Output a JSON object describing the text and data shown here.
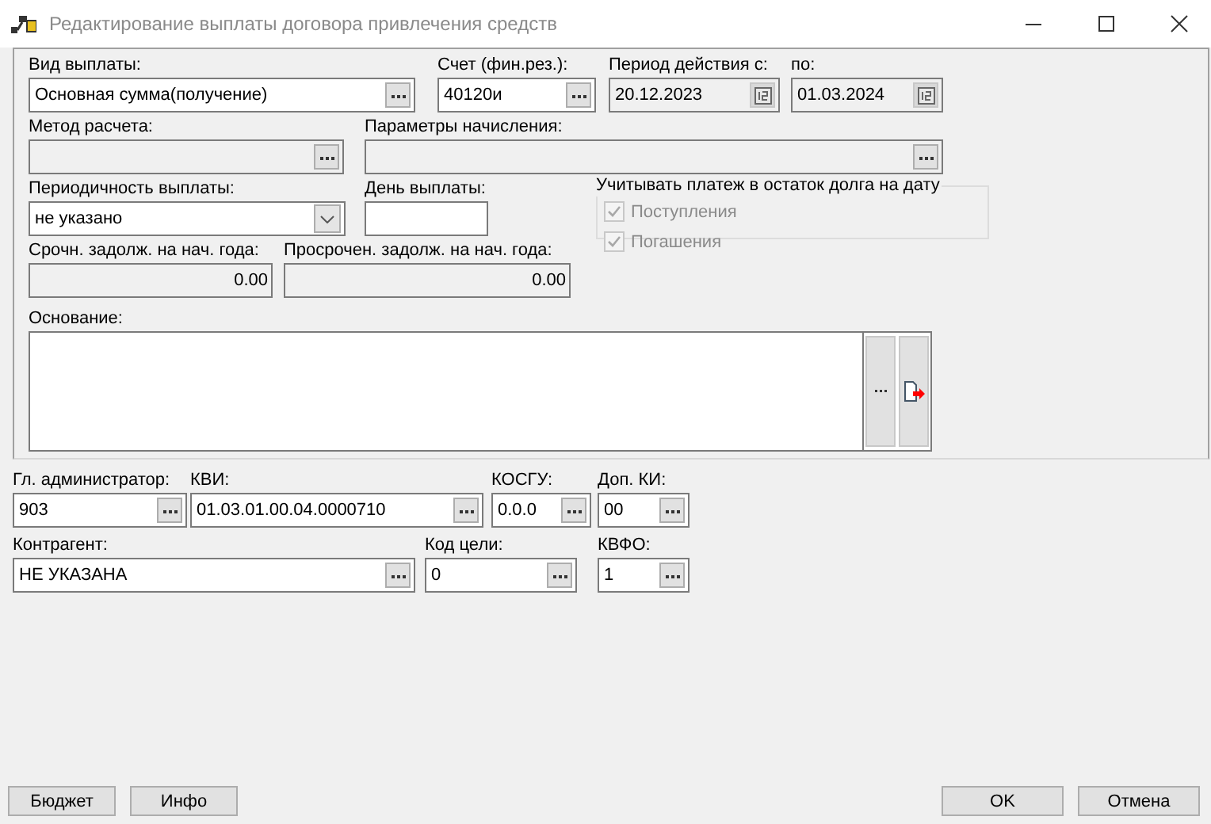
{
  "window": {
    "title": "Редактирование выплаты договора привлечения средств"
  },
  "top_rows": [
    [
      {
        "label": "Вид выплаты:",
        "value": "Основная сумма(получение)",
        "kind": "lookup",
        "disabled": false
      },
      {
        "label": "Счет (фин.рез.):",
        "value": "40120и",
        "kind": "lookup",
        "disabled": false
      },
      {
        "label": "Период действия с:",
        "value": "20.12.2023",
        "kind": "date",
        "disabled": true
      },
      {
        "label": "по:",
        "value": "01.03.2024",
        "kind": "date",
        "disabled": true
      }
    ],
    [
      {
        "label": "Метод расчета:",
        "kind": "lookup",
        "disabled": true
      },
      {
        "label": "Параметры начисления:",
        "kind": "lookup",
        "disabled": true
      }
    ],
    [
      {
        "label": "Периодичность выплаты:",
        "value": "не указано",
        "kind": "select",
        "disabled": false
      },
      {
        "label": "День выплаты:",
        "kind": "text",
        "disabled": false
      }
    ],
    [
      {
        "label": "Срочн. задолж. на нач. года:",
        "value": "0.00",
        "kind": "number",
        "disabled": true
      },
      {
        "label": "Просрочен. задолж. на нач. года:",
        "value": "0.00",
        "kind": "number",
        "disabled": true
      }
    ]
  ],
  "debt_group": {
    "title": "Учитывать платеж в остаток долга на дату",
    "checkboxes": [
      {
        "label": "Поступления",
        "checked": true,
        "disabled": true
      },
      {
        "label": "Погашения",
        "checked": true,
        "disabled": true
      }
    ]
  },
  "basis": {
    "label": "Основание:"
  },
  "bottom_rows": [
    [
      {
        "label": "Гл. администратор:",
        "value": "903",
        "kind": "lookup",
        "disabled": false
      },
      {
        "label": "КВИ:",
        "value": "01.03.01.00.04.0000710",
        "kind": "lookup",
        "disabled": false
      },
      {
        "label": "КОСГУ:",
        "value": "0.0.0",
        "kind": "lookup",
        "disabled": false
      },
      {
        "label": "Доп. КИ:",
        "value": "00",
        "kind": "lookup",
        "disabled": false
      }
    ],
    [
      {
        "label": "Контрагент:",
        "value": "НЕ УКАЗАНА",
        "kind": "lookup",
        "disabled": false
      },
      {
        "label": "Код цели:",
        "value": "0",
        "kind": "lookup",
        "disabled": false
      },
      {
        "label": "КВФО:",
        "value": "1",
        "kind": "lookup",
        "disabled": false
      }
    ]
  ],
  "left_buttons": [
    "Бюджет",
    "Инфо"
  ],
  "right_buttons": [
    "OK",
    "Отмена"
  ]
}
